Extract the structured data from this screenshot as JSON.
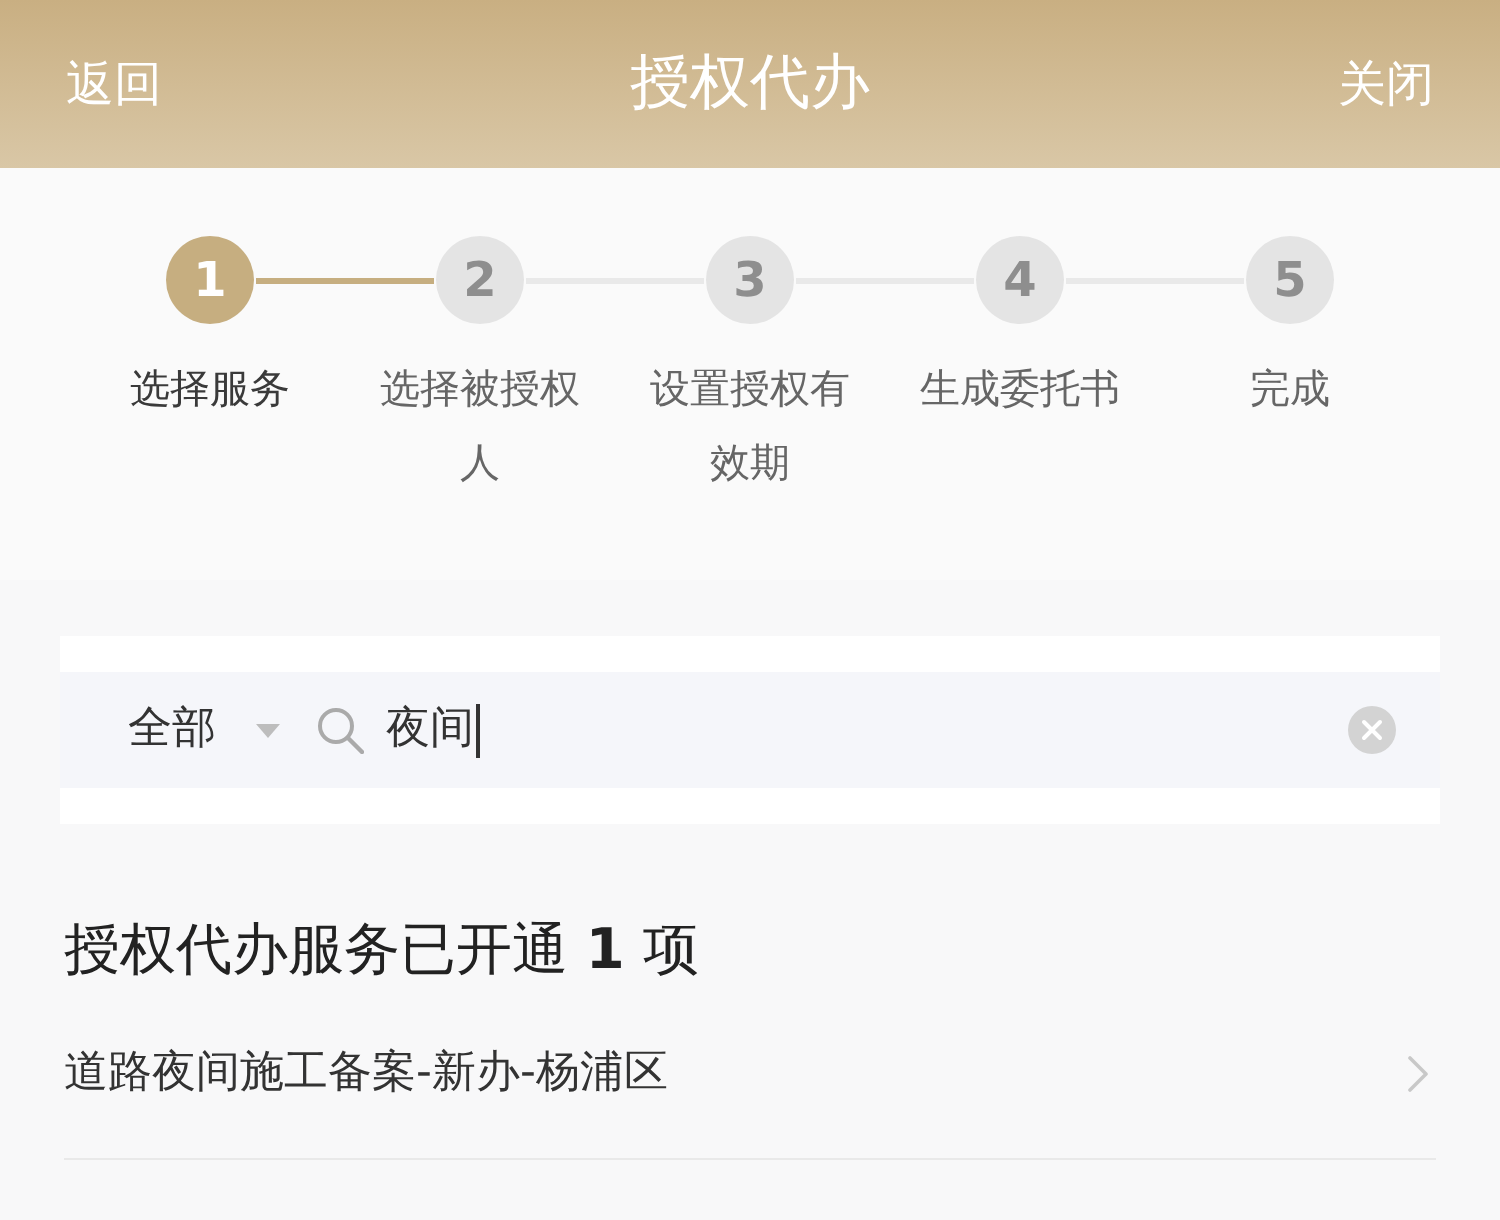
{
  "header": {
    "back": "返回",
    "title": "授权代办",
    "close": "关闭"
  },
  "steps": [
    {
      "number": "1",
      "label": "选择服务",
      "selected": true
    },
    {
      "number": "2",
      "label": "选择被授权人",
      "selected": false
    },
    {
      "number": "3",
      "label": "设置授权有效期",
      "selected": false
    },
    {
      "number": "4",
      "label": "生成委托书",
      "selected": false
    },
    {
      "number": "5",
      "label": "完成",
      "selected": false
    }
  ],
  "search": {
    "category": "全部",
    "value": "夜间",
    "focused": true
  },
  "results": {
    "heading": "授权代办服务已开通 **1** 项",
    "items": [
      {
        "label": "道路夜间施工备案-新办-杨浦区"
      }
    ]
  }
}
